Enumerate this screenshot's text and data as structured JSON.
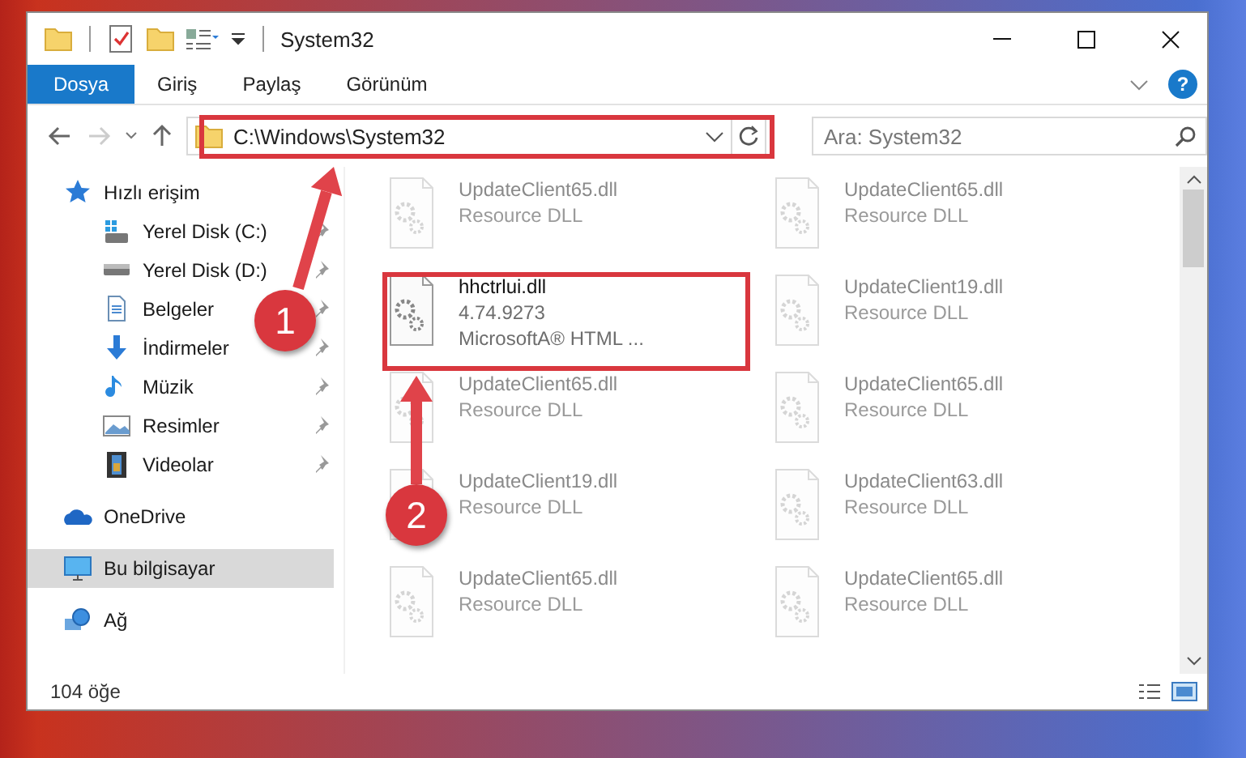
{
  "window": {
    "title": "System32"
  },
  "ribbon": {
    "tabs": [
      {
        "label": "Dosya",
        "selected": true
      },
      {
        "label": "Giriş",
        "selected": false
      },
      {
        "label": "Paylaş",
        "selected": false
      },
      {
        "label": "Görünüm",
        "selected": false
      }
    ],
    "help": "?"
  },
  "address_bar": {
    "path": "C:\\Windows\\System32",
    "search_placeholder": "Ara: System32"
  },
  "sidebar": {
    "items": [
      {
        "label": "Hızlı erişim",
        "selected": false,
        "children": [
          {
            "label": "Yerel Disk (C:)",
            "pinned": true
          },
          {
            "label": "Yerel Disk (D:)",
            "pinned": true
          },
          {
            "label": "Belgeler",
            "pinned": true
          },
          {
            "label": "İndirmeler",
            "pinned": true
          },
          {
            "label": "Müzik",
            "pinned": true
          },
          {
            "label": "Resimler",
            "pinned": true
          },
          {
            "label": "Videolar",
            "pinned": true
          }
        ]
      },
      {
        "label": "OneDrive",
        "selected": false
      },
      {
        "label": "Bu bilgisayar",
        "selected": true
      },
      {
        "label": "Ağ",
        "selected": false
      }
    ]
  },
  "files": [
    {
      "name": "UpdateClient65.dll",
      "details": [
        "Resource DLL"
      ],
      "faded": true
    },
    {
      "name": "UpdateClient65.dll",
      "details": [
        "Resource DLL"
      ],
      "faded": true
    },
    {
      "name": "hhctrlui.dll",
      "details": [
        "4.74.9273",
        "MicrosoftA® HTML ..."
      ],
      "faded": false
    },
    {
      "name": "UpdateClient19.dll",
      "details": [
        "Resource DLL"
      ],
      "faded": true
    },
    {
      "name": "UpdateClient65.dll",
      "details": [
        "Resource DLL"
      ],
      "faded": true
    },
    {
      "name": "UpdateClient65.dll",
      "details": [
        "Resource DLL"
      ],
      "faded": true
    },
    {
      "name": "UpdateClient19.dll",
      "details": [
        "Resource DLL"
      ],
      "faded": true
    },
    {
      "name": "UpdateClient63.dll",
      "details": [
        "Resource DLL"
      ],
      "faded": true
    },
    {
      "name": "UpdateClient65.dll",
      "details": [
        "Resource DLL"
      ],
      "faded": true
    },
    {
      "name": "UpdateClient65.dll",
      "details": [
        "Resource DLL"
      ],
      "faded": true
    }
  ],
  "status_bar": {
    "count": "104 öğe"
  },
  "annotations": [
    {
      "number": "1"
    },
    {
      "number": "2"
    }
  ]
}
